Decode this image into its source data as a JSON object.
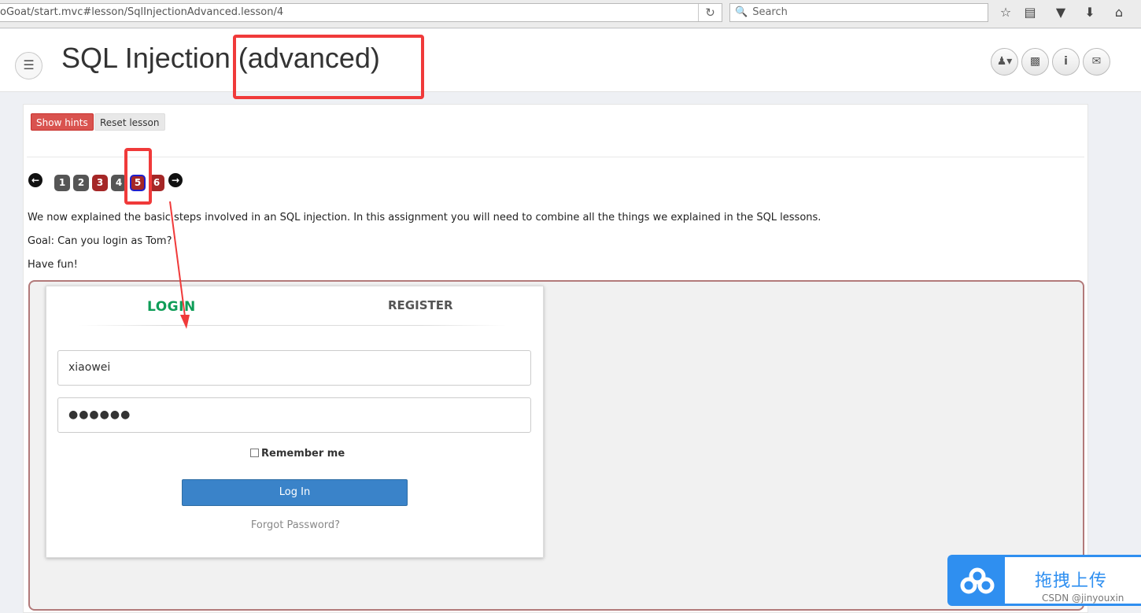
{
  "browser": {
    "url": "oGoat/start.mvc#lesson/SqlInjectionAdvanced.lesson/4",
    "search_placeholder": "Search"
  },
  "header": {
    "title": "SQL Injection (advanced)"
  },
  "toolbar": {
    "show_hints": "Show hints",
    "reset_lesson": "Reset lesson"
  },
  "pagination": {
    "pages": [
      {
        "label": "1",
        "state": "visited"
      },
      {
        "label": "2",
        "state": "visited"
      },
      {
        "label": "3",
        "state": "error"
      },
      {
        "label": "4",
        "state": "visited"
      },
      {
        "label": "5",
        "state": "active"
      },
      {
        "label": "6",
        "state": "error"
      }
    ],
    "colors": {
      "visited": "#555555",
      "error": "#a52727",
      "active_border": "#1f1fcc"
    }
  },
  "content": {
    "para1": "We now explained the basic steps involved in an SQL injection. In this assignment you will need to combine all the things we explained in the SQL lessons.",
    "para2": "Goal: Can you login as Tom?",
    "para3": "Have fun!"
  },
  "login_form": {
    "tab_login": "LOGIN",
    "tab_register": "REGISTER",
    "username_value": "xiaowei",
    "password_value": "●●●●●●",
    "remember_label": "Remember me",
    "login_button": "Log In",
    "forgot_password": "Forgot Password?"
  },
  "upload_widget": {
    "label": "拖拽上传"
  },
  "watermark": "CSDN @jinyouxin",
  "colors": {
    "accent_green": "#0f9d58",
    "button_blue": "#3a83c9",
    "hint_red": "#d9534f",
    "annotation_red": "#f03a3a"
  }
}
